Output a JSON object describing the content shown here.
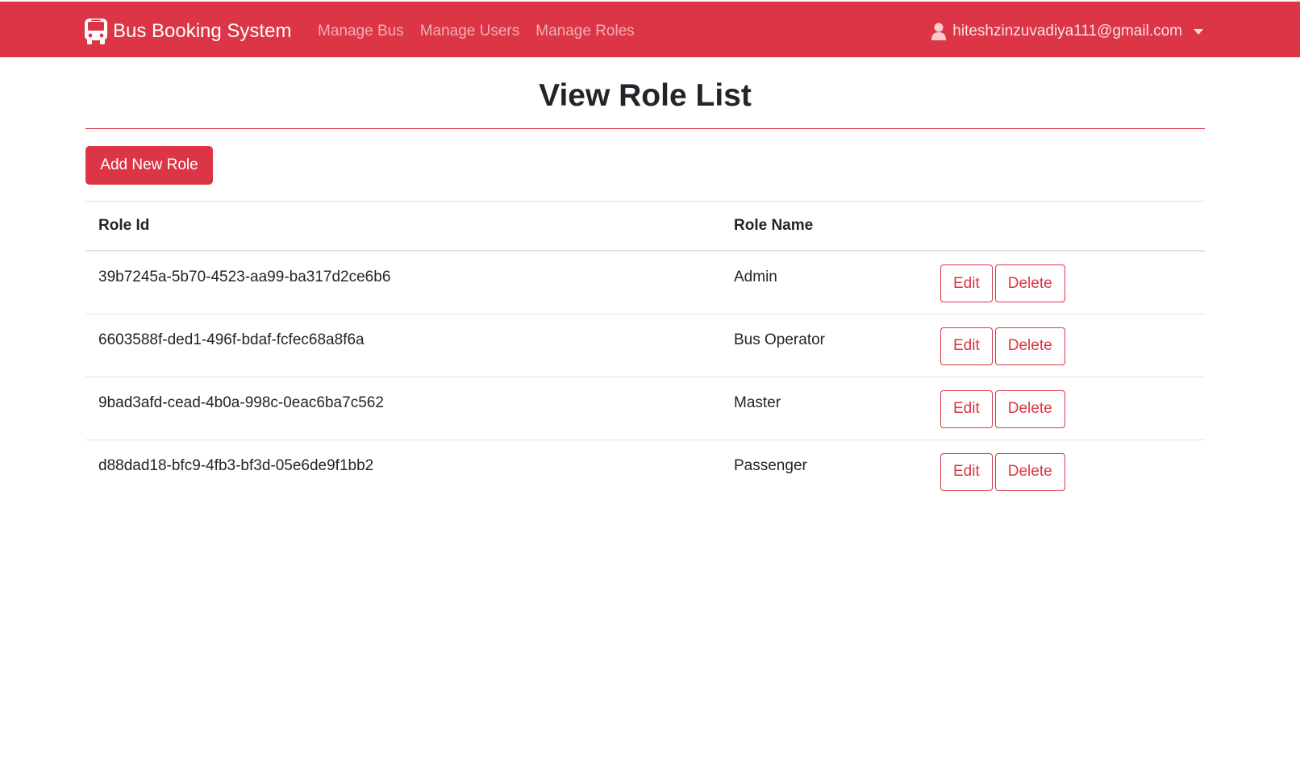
{
  "navbar": {
    "brand": "Bus Booking System",
    "brand_icon": "bus-icon",
    "links": [
      "Manage Bus",
      "Manage Users",
      "Manage Roles"
    ],
    "user_email": "hiteshzinzuvadiya111@gmail.com",
    "user_icon": "user-icon",
    "color": "#dc3545"
  },
  "page": {
    "title": "View Role List",
    "add_button": "Add New Role"
  },
  "table": {
    "headers": [
      "Role Id",
      "Role Name",
      ""
    ],
    "rows": [
      {
        "id": "39b7245a-5b70-4523-aa99-ba317d2ce6b6",
        "name": "Admin",
        "edit": "Edit",
        "delete": "Delete"
      },
      {
        "id": "6603588f-ded1-496f-bdaf-fcfec68a8f6a",
        "name": "Bus Operator",
        "edit": "Edit",
        "delete": "Delete"
      },
      {
        "id": "9bad3afd-cead-4b0a-998c-0eac6ba7c562",
        "name": "Master",
        "edit": "Edit",
        "delete": "Delete"
      },
      {
        "id": "d88dad18-bfc9-4fb3-bf3d-05e6de9f1bb2",
        "name": "Passenger",
        "edit": "Edit",
        "delete": "Delete"
      }
    ]
  }
}
